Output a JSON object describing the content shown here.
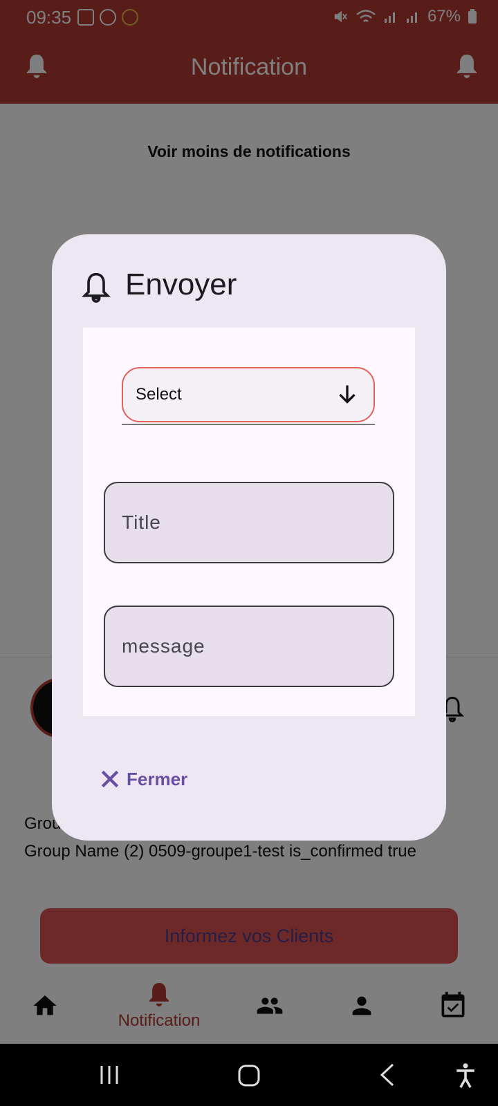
{
  "status_bar": {
    "time": "09:35",
    "battery": "67%",
    "icons_left": [
      "gallery-icon",
      "alarm-icon",
      "app-icon"
    ],
    "icons_right": [
      "mute-icon",
      "wifi-icon",
      "signal-icon",
      "signal-icon",
      "battery-icon"
    ]
  },
  "app_bar": {
    "title": "Notification",
    "left_icon": "bell-icon",
    "right_icon": "bell-icon",
    "color": "#b33a32"
  },
  "main": {
    "see_less_link": "Voir moins de notifications",
    "group_line_partial": "Grou",
    "group_line_2": "Group Name (2) 0509-groupe1-test is_confirmed true",
    "cta_button": "Informez vos Clients"
  },
  "dialog": {
    "title": "Envoyer",
    "title_icon": "bell-outline-icon",
    "select": {
      "value": "Select",
      "icon": "arrow-down-icon"
    },
    "title_field": {
      "placeholder": "Title",
      "value": ""
    },
    "message_field": {
      "placeholder": "message",
      "value": ""
    },
    "close_button": {
      "label": "Fermer",
      "icon": "close-icon"
    }
  },
  "bottom_nav": {
    "items": [
      {
        "icon": "home-icon",
        "label": ""
      },
      {
        "icon": "bell-icon",
        "label": "Notification",
        "active": true
      },
      {
        "icon": "group-icon",
        "label": ""
      },
      {
        "icon": "person-icon",
        "label": ""
      },
      {
        "icon": "calendar-check-icon",
        "label": ""
      }
    ]
  },
  "system_nav": {
    "buttons": [
      "recents-icon",
      "home-icon",
      "back-icon",
      "accessibility-icon"
    ]
  },
  "colors": {
    "brand": "#b33a32",
    "dialog_bg": "#ece7f3",
    "accent": "#6750a4"
  }
}
